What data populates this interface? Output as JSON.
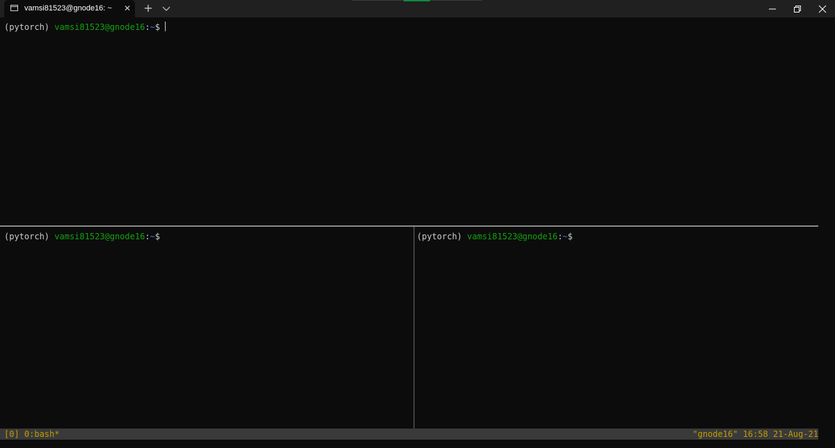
{
  "window": {
    "tab_title": "vamsi81523@gnode16: ~",
    "tab_close": "✕",
    "new_tab": "+",
    "colors": {
      "background": "#0c0c0c",
      "titlebar": "#202020",
      "prompt_user": "#13a10e",
      "prompt_path": "#3b78ff",
      "status_text": "#c19c00",
      "status_bg": "#3a3a3a"
    }
  },
  "panes": {
    "top": {
      "env": "(pytorch)",
      "user_host": "vamsi81523@gnode16",
      "colon": ":",
      "path": "~",
      "dollar": "$"
    },
    "bottom_left": {
      "env": "(pytorch)",
      "user_host": "vamsi81523@gnode16",
      "colon": ":",
      "path": "~",
      "dollar": "$"
    },
    "bottom_right": {
      "env": "(pytorch)",
      "user_host": "vamsi81523@gnode16",
      "colon": ":",
      "path": "~",
      "dollar": "$"
    }
  },
  "statusbar": {
    "left": "[0] 0:bash*",
    "right": "\"gnode16\" 16:58 21-Aug-21"
  },
  "icons": {
    "tab_icon": "terminal-icon",
    "minimize": "minimize-icon",
    "maximize": "restore-icon",
    "close": "close-icon",
    "dropdown": "chevron-down-icon"
  }
}
